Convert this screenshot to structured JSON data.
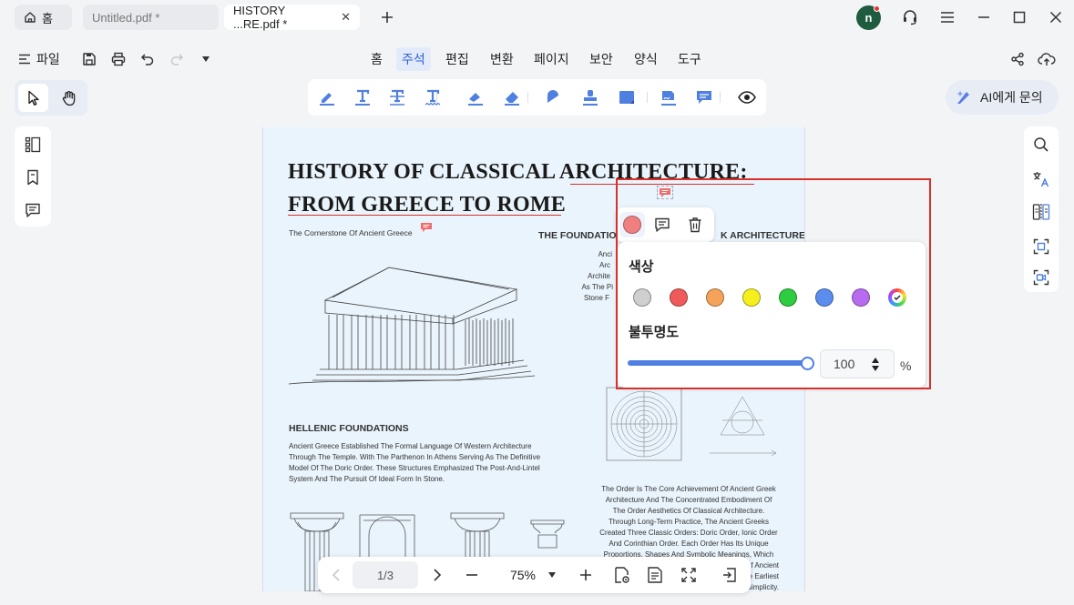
{
  "tabs": {
    "home_label": "홈",
    "items": [
      {
        "label": "Untitled.pdf *"
      },
      {
        "label": "HISTORY ...RE.pdf *"
      }
    ]
  },
  "user": {
    "avatar_letter": "n"
  },
  "menu": {
    "file_label": "파일",
    "tabs": [
      {
        "label": "홈"
      },
      {
        "label": "주석"
      },
      {
        "label": "편집"
      },
      {
        "label": "변환"
      },
      {
        "label": "페이지"
      },
      {
        "label": "보안"
      },
      {
        "label": "양식"
      },
      {
        "label": "도구"
      }
    ],
    "active_tab": "주석"
  },
  "ai_button": {
    "label": "AI에게 문의"
  },
  "document": {
    "title_line1": "HISTORY OF CLASSICAL  ARCHITECTURE:",
    "title_line2": "FROM GREECE TO ROME",
    "subtitle": "The Cornerstone Of Ancient Greece",
    "section_right": "THE FOUNDATION",
    "section_right_tail": "K ARCHITECTURE",
    "right_col_lines": [
      "Anci",
      "Arc",
      "Archite",
      "As The Pi",
      "Stone F"
    ],
    "hellenic_heading": "HELLENIC FOUNDATIONS",
    "hellenic_text": "Ancient Greece Established The Formal Language Of Western Architecture Through The Temple. With The Parthenon In Athens Serving As The Definitive Model Of The Doric Order. These Structures Emphasized The Post-And-Lintel System And The Pursuit Of Ideal Form In Stone.",
    "orders_text": [
      "The Order Is The Core Achievement Of Ancient Greek",
      "Architecture And The Concentrated Embodiment Of",
      "The Order Aesthetics Of Classical Architecture.",
      "Through Long-Term Practice, The Ancient Greeks",
      "Created Three Classic Orders: Doric Order, Ionic Order",
      "And Corinthian Order. Each Order Has Its Unique",
      "Proportions, Shapes And Symbolic Meanings, Which",
      "f Ancient",
      "e Earliest",
      "simplicity."
    ]
  },
  "popup": {
    "color_label": "색상",
    "opacity_label": "불투명도",
    "opacity_value": "100",
    "opacity_unit": "%",
    "opacity_fraction": 1.0,
    "selected_color": "#f08080",
    "swatches": [
      "#cfcfcf",
      "#f05a5a",
      "#f5a35a",
      "#f5ef1e",
      "#2ecc40",
      "#5b8def",
      "#b76cf0",
      "custom"
    ]
  },
  "bottom": {
    "page_indicator": "1/3",
    "zoom": "75%"
  },
  "colors": {
    "accent": "#2b5fd9",
    "highlight_red": "#d9302a",
    "tool_blue": "#4f7fe0"
  }
}
